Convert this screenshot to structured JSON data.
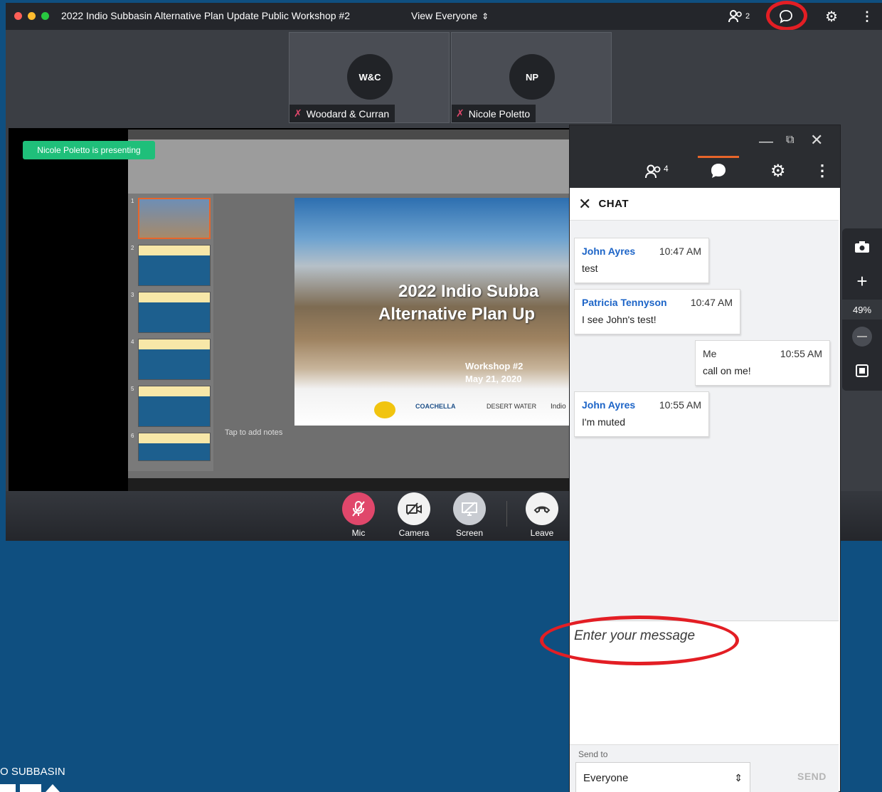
{
  "window": {
    "title": "2022 Indio Subbasin Alternative Plan Update Public Workshop #2",
    "view_label": "View Everyone",
    "participants_count": "2"
  },
  "participants": [
    {
      "initials": "W&C",
      "name": "Woodard & Curran"
    },
    {
      "initials": "NP",
      "name": "Nicole Poletto"
    }
  ],
  "presenting_banner": "Nicole Poletto is presenting",
  "slide": {
    "title_line1": "2022 Indio Subba",
    "title_line2": "Alternative Plan Up",
    "workshop": "Workshop #2",
    "date": "May 21, 2020",
    "logo1": "COACHELLA",
    "logo2": "DESERT WATER",
    "logo3": "Indio",
    "notes_placeholder": "Tap to add notes"
  },
  "controls": {
    "mic": "Mic",
    "camera": "Camera",
    "screen": "Screen",
    "leave": "Leave"
  },
  "chat_window": {
    "participants_count": "4",
    "header": "CHAT",
    "messages": [
      {
        "sender": "John Ayres",
        "time": "10:47 AM",
        "text": "test"
      },
      {
        "sender": "Patricia Tennyson",
        "time": "10:47 AM",
        "text": "I see John's test!"
      },
      {
        "sender": "Me",
        "time": "10:55 AM",
        "text": "call on me!"
      },
      {
        "sender": "John Ayres",
        "time": "10:55 AM",
        "text": "I'm muted"
      }
    ],
    "input_placeholder": "Enter your message",
    "send_to_label": "Send to",
    "send_to_value": "Everyone",
    "send_label": "SEND"
  },
  "zoom_level": "49%",
  "logo_text": "O SUBBASIN",
  "colors": {
    "accent_orange": "#e8652a",
    "mic_red": "#e0476b",
    "presenting_green": "#1fbf7a",
    "annotation_red": "#e31e24",
    "sender_blue": "#1c64c7"
  }
}
